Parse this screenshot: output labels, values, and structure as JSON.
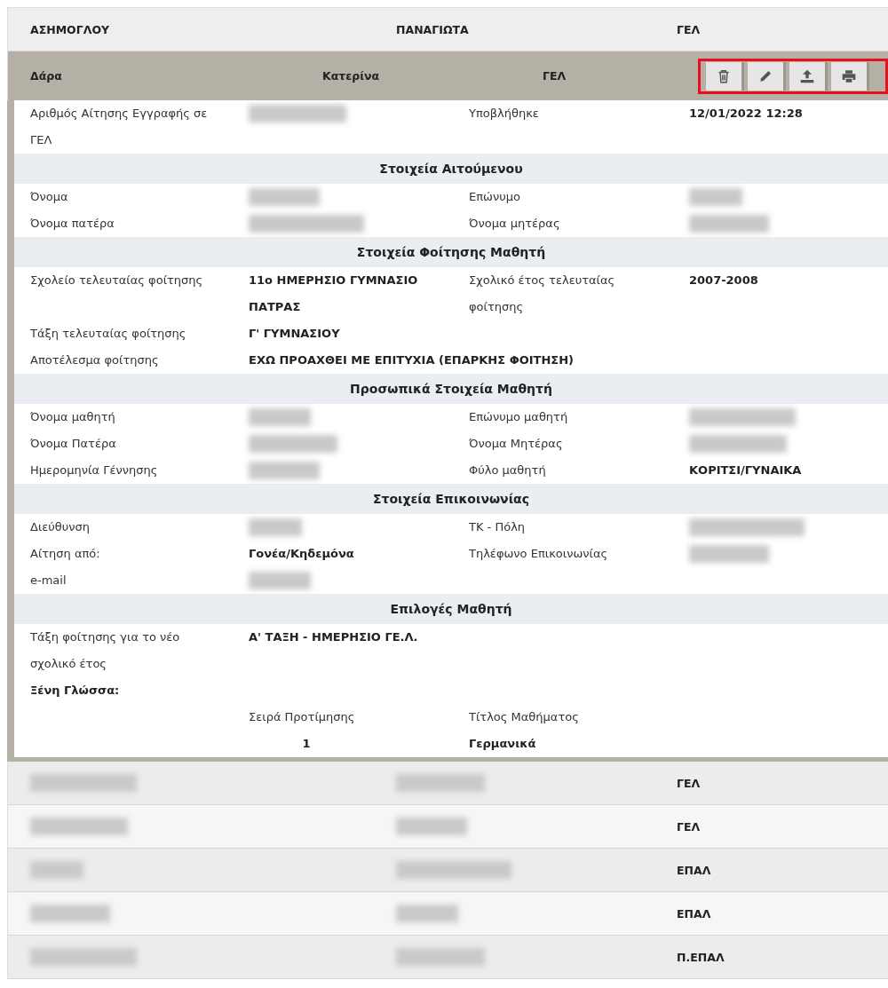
{
  "rows_before": [
    {
      "cells": [
        {
          "text": "ΑΣΗΜΟΓΛΟΥ",
          "redacted": false
        },
        {
          "text": "ΠΑΝΑΓΙΩΤΑ",
          "redacted": false
        },
        {
          "text": "ΓΕΛ",
          "redacted": false
        }
      ]
    }
  ],
  "expanded": {
    "cells": [
      {
        "text": "Δάρα",
        "redacted": false
      },
      {
        "text": "Κατερίνα",
        "redacted": false
      },
      {
        "text": "ΓΕΛ",
        "redacted": false
      }
    ],
    "actions_highlighted": true,
    "actions": [
      {
        "kind": "delete"
      },
      {
        "kind": "edit"
      },
      {
        "kind": "upload"
      },
      {
        "kind": "print"
      }
    ],
    "sections": [
      {
        "rows": [
          [
            {
              "label": "Αριθμός Αίτησης Εγγραφής σε ΓΕΛ",
              "redacted": true
            },
            {
              "label": "Υποβλήθηκε",
              "value": "12/01/2022 12:28",
              "redacted": false
            }
          ]
        ]
      },
      {
        "title": "Στοιχεία Αιτούμενου",
        "rows": [
          [
            {
              "label": "Όνομα",
              "redacted": true
            },
            {
              "label": "Επώνυμο",
              "redacted": true
            }
          ],
          [
            {
              "label": "Όνομα πατέρα",
              "redacted": true
            },
            {
              "label": "Όνομα μητέρας",
              "redacted": true
            }
          ]
        ]
      },
      {
        "title": "Στοιχεία Φοίτησης Μαθητή",
        "rows": [
          [
            {
              "label": "Σχολείο τελευταίας φοίτησης",
              "value": "11ο ΗΜΕΡΗΣΙΟ ΓΥΜΝΑΣΙΟ ΠΑΤΡΑΣ",
              "redacted": false
            },
            {
              "label": "Σχολικό έτος τελευταίας φοίτησης",
              "value": "2007-2008",
              "redacted": false
            }
          ],
          [
            {
              "label": "Τάξη τελευταίας φοίτησης",
              "value": "Γ' ΓΥΜΝΑΣΙΟΥ",
              "redacted": false
            }
          ],
          [
            {
              "label": "Αποτέλεσμα φοίτησης",
              "value": "ΕΧΩ ΠΡΟΑΧΘΕΙ ΜΕ ΕΠΙΤΥΧΙΑ (ΕΠΑΡΚΗΣ ΦΟΙΤΗΣΗ)",
              "redacted": false
            }
          ]
        ]
      },
      {
        "title": "Προσωπικά Στοιχεία Μαθητή",
        "rows": [
          [
            {
              "label": "Όνομα μαθητή",
              "redacted": true
            },
            {
              "label": "Επώνυμο μαθητή",
              "redacted": true
            }
          ],
          [
            {
              "label": "Όνομα Πατέρα",
              "redacted": true
            },
            {
              "label": "Όνομα Μητέρας",
              "redacted": true
            }
          ],
          [
            {
              "label": "Ημερομηνία Γέννησης",
              "redacted": true
            },
            {
              "label": "Φύλο μαθητή",
              "value": "ΚΟΡΙΤΣΙ/ΓΥΝΑΙΚΑ",
              "redacted": false
            }
          ]
        ]
      },
      {
        "title": "Στοιχεία Επικοινωνίας",
        "rows": [
          [
            {
              "label": "Διεύθυνση",
              "redacted": true
            },
            {
              "label": "ΤΚ - Πόλη",
              "redacted": true
            }
          ],
          [
            {
              "label": "Αίτηση από:",
              "value": "Γονέα/Κηδεμόνα",
              "redacted": false
            },
            {
              "label": "Τηλέφωνο Επικοινωνίας",
              "redacted": true
            }
          ],
          [
            {
              "label": "e-mail",
              "redacted": true
            }
          ]
        ]
      },
      {
        "title": "Επιλογές Μαθητή",
        "rows": [
          [
            {
              "label": "Τάξη φοίτησης για το νέο σχολικό έτος",
              "value": "Α' ΤΑΞΗ - ΗΜΕΡΗΣΙΟ ΓΕ.Λ.",
              "redacted": false
            }
          ]
        ],
        "subtable": {
          "title": "Ξένη Γλώσσα:",
          "columns": [
            "Σειρά Προτίμησης",
            "Τίτλος Μαθήματος"
          ],
          "rows": [
            [
              "1",
              "Γερμανικά"
            ]
          ]
        }
      }
    ]
  },
  "rows_after": [
    {
      "cells": [
        {
          "redacted": true
        },
        {
          "redacted": true
        },
        {
          "text": "ΓΕΛ",
          "redacted": false
        }
      ]
    },
    {
      "cells": [
        {
          "redacted": true
        },
        {
          "redacted": true
        },
        {
          "text": "ΓΕΛ",
          "redacted": false
        }
      ]
    },
    {
      "cells": [
        {
          "redacted": true
        },
        {
          "redacted": true
        },
        {
          "text": "ΕΠΑΛ",
          "redacted": false
        }
      ]
    },
    {
      "cells": [
        {
          "redacted": true
        },
        {
          "redacted": true
        },
        {
          "text": "ΕΠΑΛ",
          "redacted": false
        }
      ]
    },
    {
      "cells": [
        {
          "redacted": true
        },
        {
          "redacted": true
        },
        {
          "text": "Π.ΕΠΑΛ",
          "redacted": false
        }
      ]
    }
  ]
}
